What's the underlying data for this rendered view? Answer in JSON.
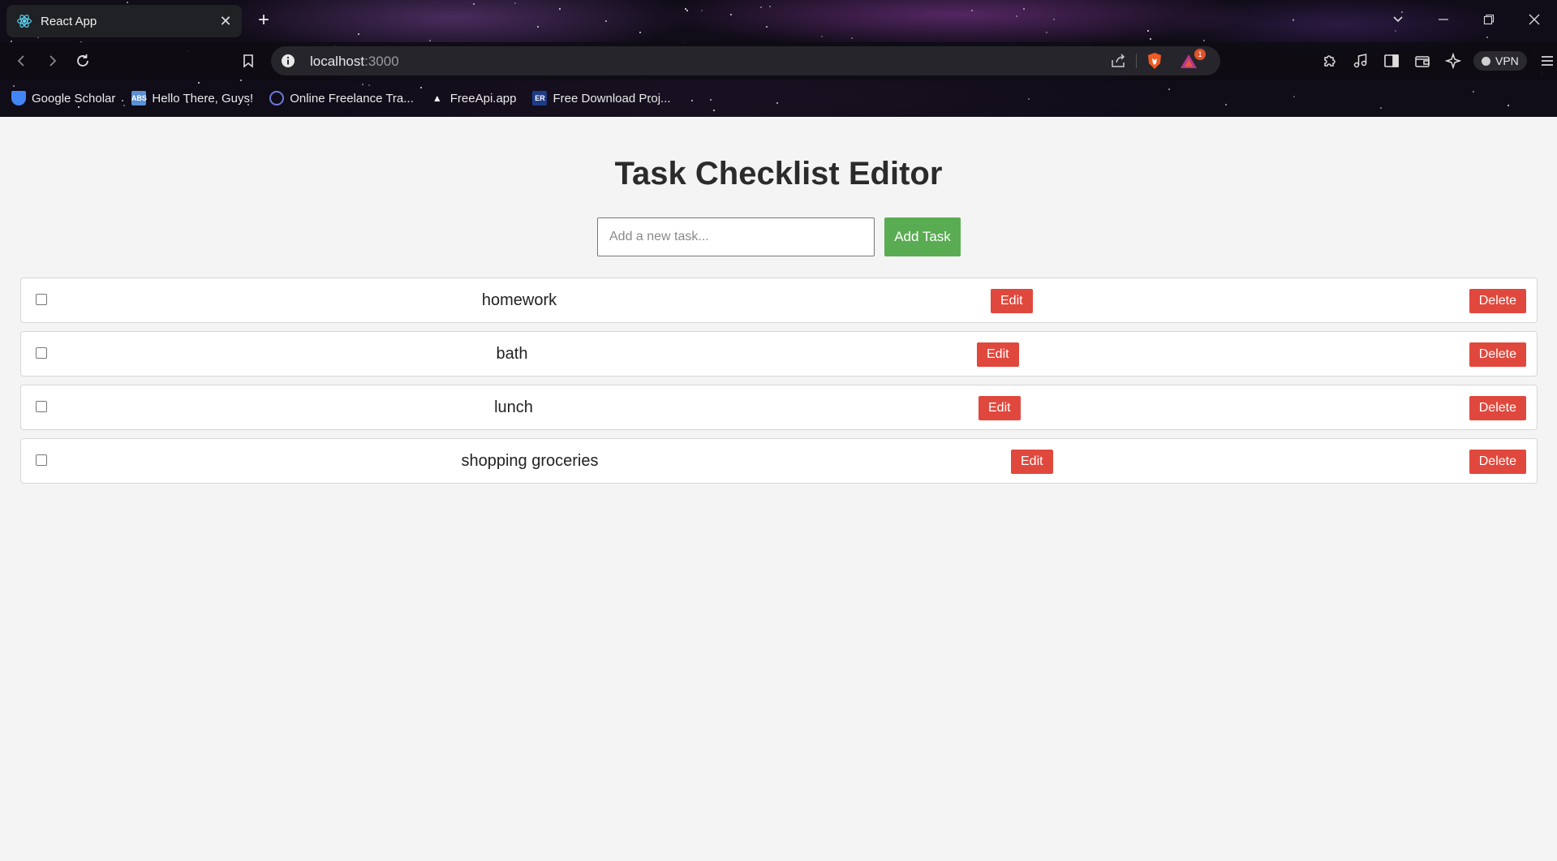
{
  "browser": {
    "tab_title": "React App",
    "new_tab_icon": "plus-icon",
    "url_host": "localhost",
    "url_port": ":3000",
    "rewards_badge": "1",
    "vpn_label": "VPN",
    "bookmarks": [
      {
        "label": "Google Scholar",
        "icon": "google-scholar-icon",
        "icon_text": ""
      },
      {
        "label": "Hello There, Guys!",
        "icon": "abs-icon",
        "icon_text": "ABS"
      },
      {
        "label": "Online Freelance Tra...",
        "icon": "freelance-icon",
        "icon_text": ""
      },
      {
        "label": "FreeApi.app",
        "icon": "triangle-icon",
        "icon_text": "▲"
      },
      {
        "label": "Free Download Proj...",
        "icon": "er-icon",
        "icon_text": "ER"
      }
    ]
  },
  "app": {
    "title": "Task Checklist Editor",
    "input_placeholder": "Add a new task...",
    "add_button": "Add Task",
    "edit_label": "Edit",
    "delete_label": "Delete",
    "tasks": [
      {
        "text": "homework",
        "checked": false
      },
      {
        "text": "bath",
        "checked": false
      },
      {
        "text": "lunch",
        "checked": false
      },
      {
        "text": "shopping groceries",
        "checked": false
      }
    ]
  },
  "colors": {
    "add_button": "#5aac52",
    "danger_button": "#e0483d",
    "page_bg": "#f4f4f4"
  }
}
